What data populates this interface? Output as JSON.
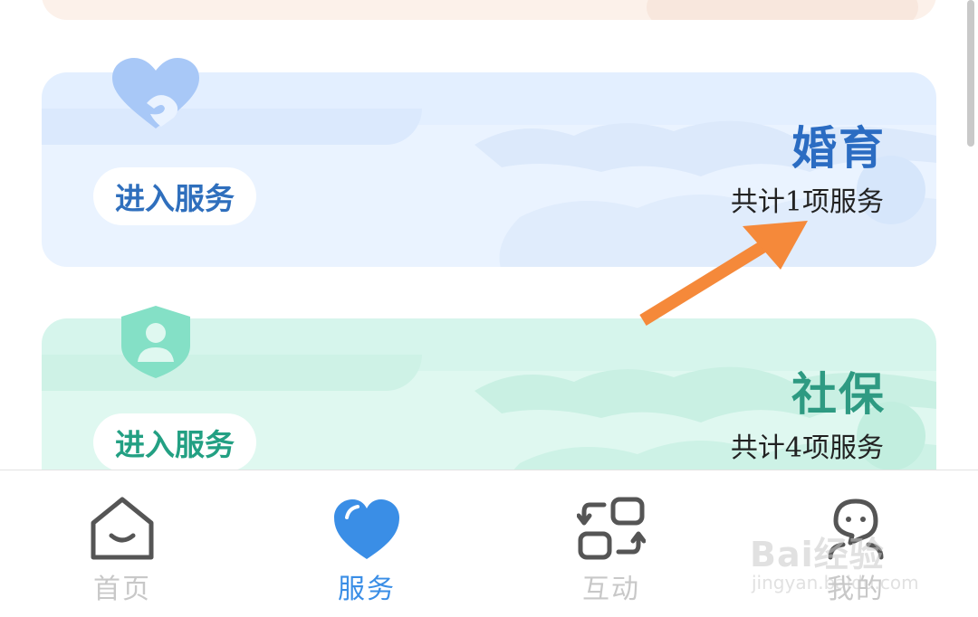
{
  "cards": [
    {
      "id": "marriage",
      "title": "婚育",
      "count_text": "共计1项服务",
      "button_label": "进入服务",
      "icon": "heart-hand-icon",
      "accent": "#2b6cc2",
      "background": "#eaf3ff"
    },
    {
      "id": "social",
      "title": "社保",
      "count_text": "共计4项服务",
      "button_label": "进入服务",
      "icon": "shield-person-icon",
      "accent": "#2e9a82",
      "background": "#dff8f0"
    }
  ],
  "annotation": {
    "icon": "orange-arrow-icon",
    "color": "#f5893a"
  },
  "tabbar": {
    "active_tab": "服务",
    "tabs": [
      {
        "label": "首页",
        "icon": "home-icon"
      },
      {
        "label": "服务",
        "icon": "heart-icon"
      },
      {
        "label": "互动",
        "icon": "interaction-icon"
      },
      {
        "label": "我的",
        "icon": "profile-icon"
      }
    ]
  },
  "watermark": {
    "text": "Bai经验",
    "url": "jingyan.baidu.com"
  },
  "colors": {
    "active_tab": "#3a8ee6",
    "inactive_tab": "#c8c8c8"
  }
}
